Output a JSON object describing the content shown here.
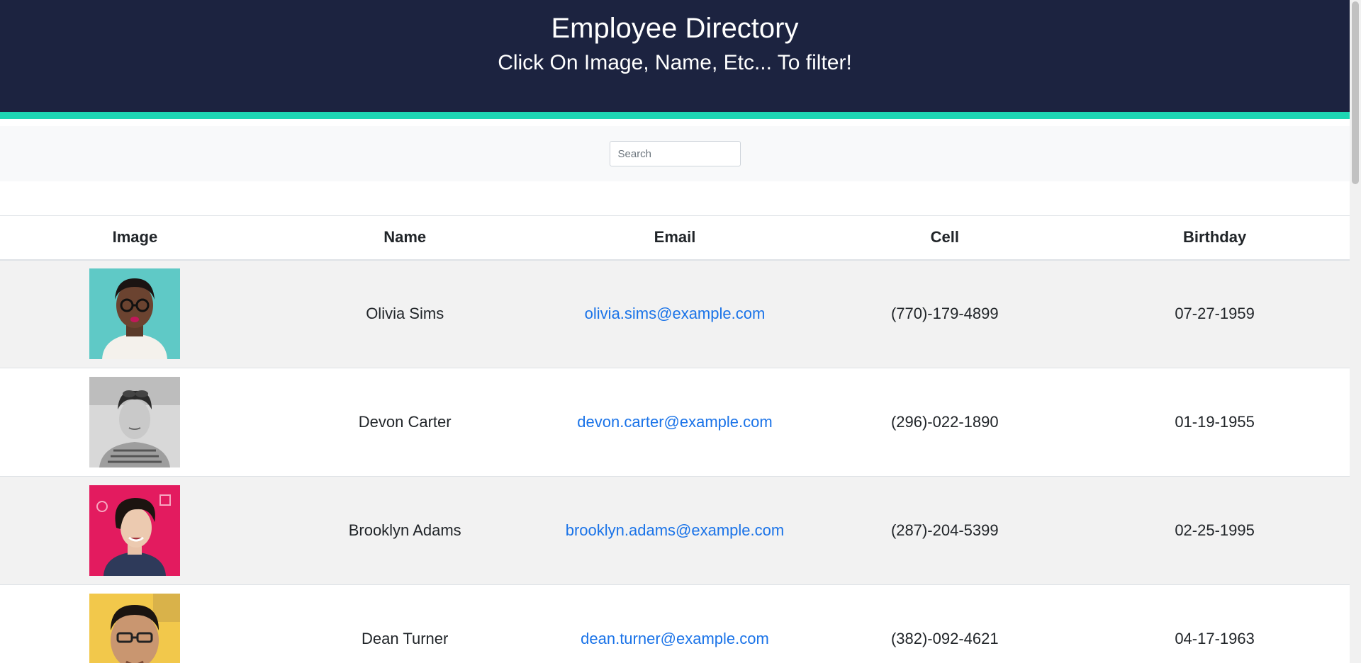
{
  "header": {
    "title": "Employee Directory",
    "subtitle": "Click On Image, Name, Etc... To filter!"
  },
  "search": {
    "placeholder": "Search",
    "value": ""
  },
  "table": {
    "columns": [
      "Image",
      "Name",
      "Email",
      "Cell",
      "Birthday"
    ],
    "rows": [
      {
        "name": "Olivia Sims",
        "email": "olivia.sims@example.com",
        "cell": "(770)-179-4899",
        "birthday": "07-27-1959"
      },
      {
        "name": "Devon Carter",
        "email": "devon.carter@example.com",
        "cell": "(296)-022-1890",
        "birthday": "01-19-1955"
      },
      {
        "name": "Brooklyn Adams",
        "email": "brooklyn.adams@example.com",
        "cell": "(287)-204-5399",
        "birthday": "02-25-1995"
      },
      {
        "name": "Dean Turner",
        "email": "dean.turner@example.com",
        "cell": "(382)-092-4621",
        "birthday": "04-17-1963"
      }
    ]
  },
  "colors": {
    "header_bg": "#1c2340",
    "accent": "#1ed6b4",
    "link": "#1a73e8"
  }
}
